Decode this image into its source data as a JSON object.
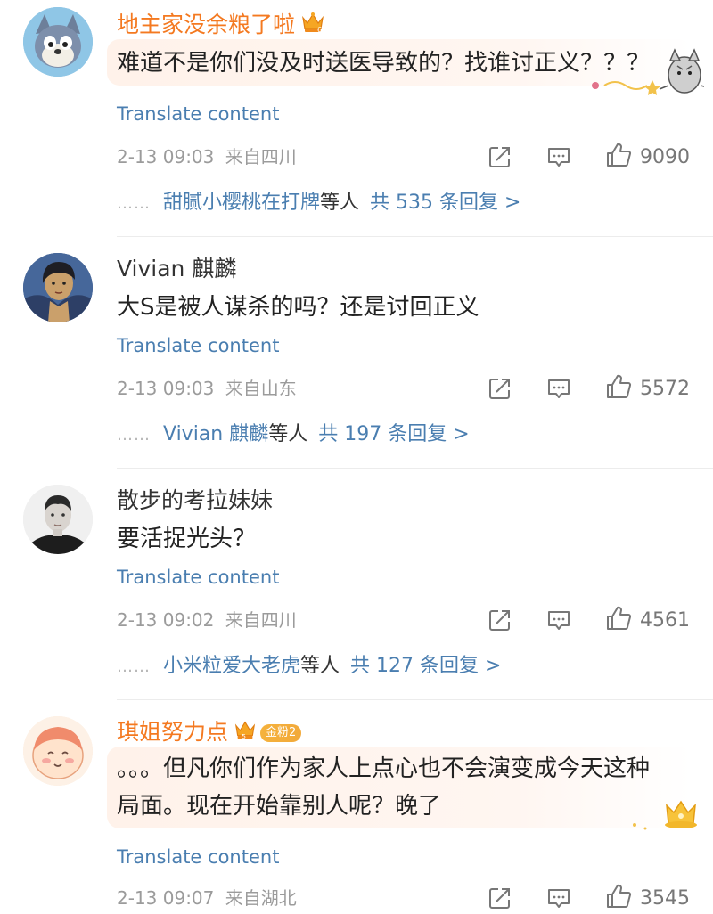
{
  "comments": [
    {
      "username": "地主家没余粮了啦",
      "text": "难道不是你们没及时送医导致的？找谁讨正义？？？",
      "translate": "Translate content",
      "date": "2-13 09:03",
      "location": "来自四川",
      "likes": "9090",
      "reply_names": "甜腻小樱桃在打牌",
      "reply_suffix": "等人",
      "reply_total": "共 535 条回复 >"
    },
    {
      "username": "Vivian 麒麟",
      "text": "大S是被人谋杀的吗？还是讨回正义",
      "translate": "Translate content",
      "date": "2-13 09:03",
      "location": "来自山东",
      "likes": "5572",
      "reply_names": "Vivian 麒麟",
      "reply_suffix": "等人",
      "reply_total": "共 197 条回复 >"
    },
    {
      "username": "散步的考拉妹妹",
      "text": "要活捉光头？",
      "translate": "Translate content",
      "date": "2-13 09:02",
      "location": "来自四川",
      "likes": "4561",
      "reply_names": "小米粒爱大老虎",
      "reply_suffix": "等人",
      "reply_total": "共 127 条回复 >"
    },
    {
      "username": "琪姐努力点",
      "fan_badge": "金粉2",
      "text": "。。。但凡你们作为家人上点心也不会演变成今天这种局面。现在开始靠别人呢？晚了",
      "translate": "Translate content",
      "date": "2-13 09:07",
      "location": "来自湖北",
      "likes": "3545"
    }
  ],
  "icons": {
    "share": "share-icon",
    "comment": "comment-icon",
    "like": "like-icon"
  },
  "colors": {
    "vip_name": "#f47920",
    "link": "#4a7eb0",
    "meta": "#9b9b9b"
  }
}
